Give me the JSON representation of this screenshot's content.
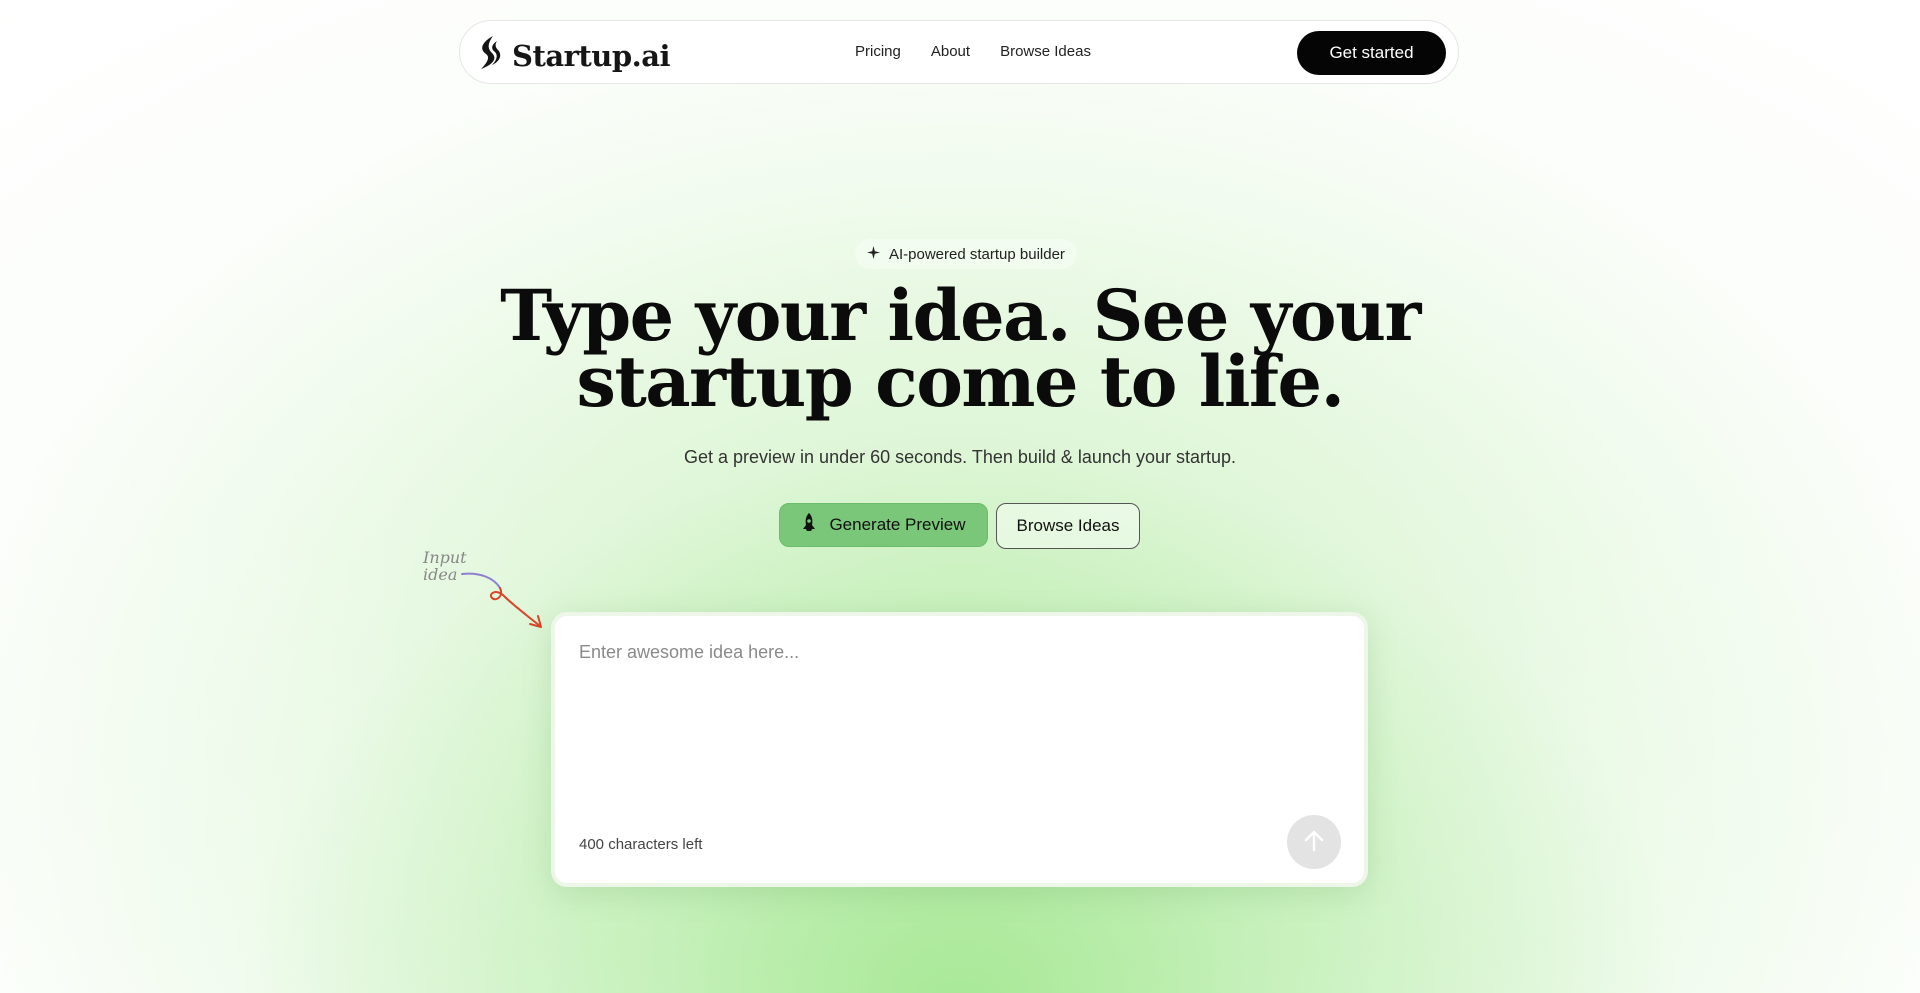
{
  "nav": {
    "brand": "Startup.ai",
    "links": [
      "Pricing",
      "About",
      "Browse Ideas"
    ],
    "cta_label": "Get started"
  },
  "hero": {
    "badge": "AI-powered startup builder",
    "headline_line1": "Type your idea. See your",
    "headline_line2": "startup come to life.",
    "subheadline": "Get a preview in under 60 seconds. Then build & launch your startup.",
    "primary_button": "Generate Preview",
    "secondary_button": "Browse Ideas"
  },
  "hint": {
    "line1": "Input",
    "line2": "idea"
  },
  "idea_box": {
    "value": "",
    "placeholder": "Enter awesome idea here...",
    "counter": "400 characters left"
  },
  "colors": {
    "primary_green": "#7ac77a",
    "cta_black": "#050505",
    "arrow_purple": "#8f7fd0",
    "arrow_red": "#d9452a"
  },
  "icons": {
    "logo": "flame-logo-icon",
    "badge": "sparkle-icon",
    "primary_button": "rocket-icon",
    "submit": "arrow-up-icon"
  }
}
